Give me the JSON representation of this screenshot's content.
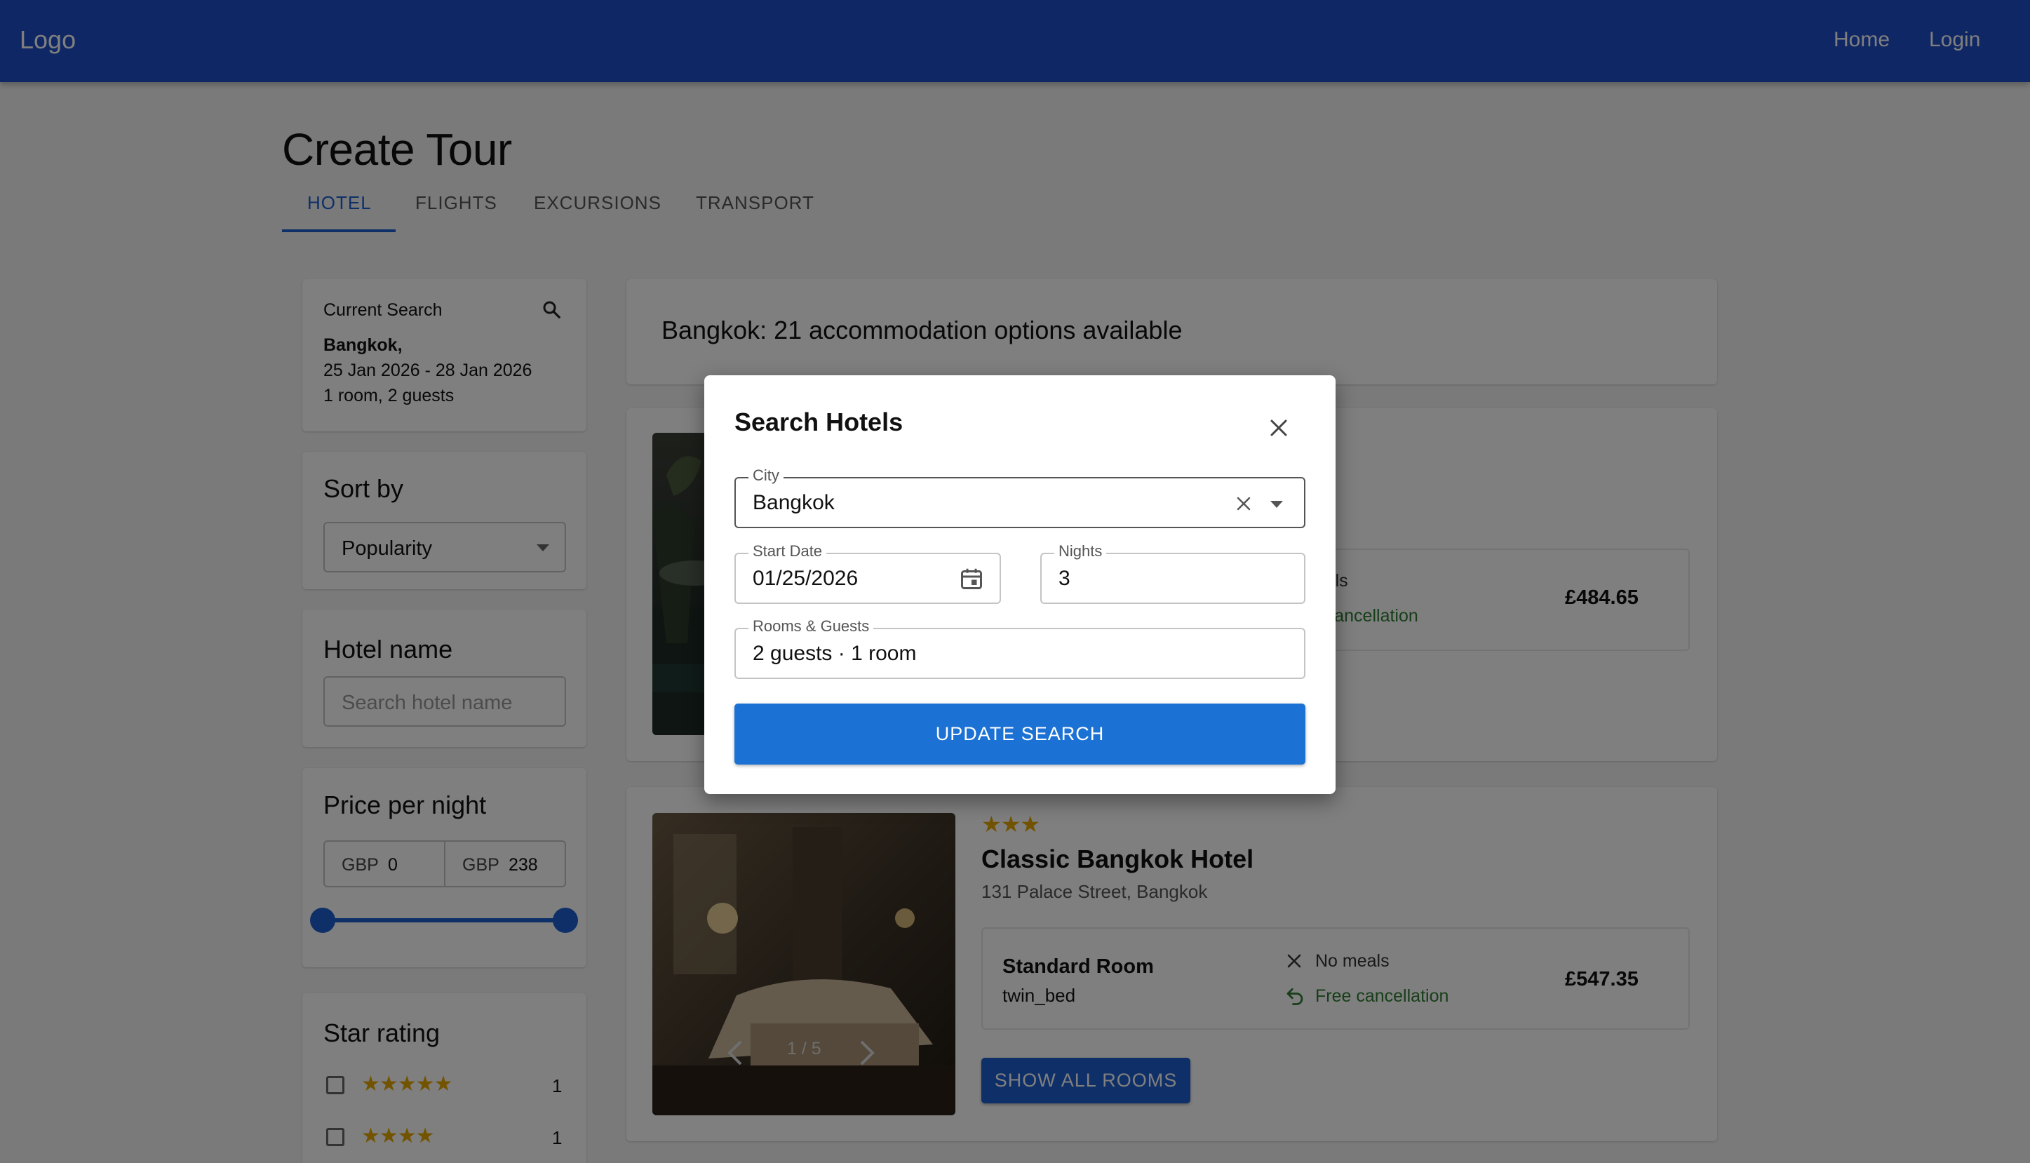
{
  "header": {
    "logo": "Logo",
    "nav": {
      "home": "Home",
      "login": "Login"
    }
  },
  "page": {
    "title": "Create Tour",
    "tabs": [
      {
        "label": "HOTEL",
        "active": true
      },
      {
        "label": "FLIGHTS",
        "active": false
      },
      {
        "label": "EXCURSIONS",
        "active": false
      },
      {
        "label": "TRANSPORT",
        "active": false
      }
    ]
  },
  "sidebar": {
    "current_search": {
      "title": "Current Search",
      "city": "Bangkok,",
      "dates": "25 Jan 2026 - 28 Jan 2026",
      "guests": "1 room, 2 guests"
    },
    "sort": {
      "heading": "Sort by",
      "value": "Popularity"
    },
    "hotel_name": {
      "heading": "Hotel name",
      "placeholder": "Search hotel name"
    },
    "price": {
      "heading": "Price per night",
      "currency_min": "GBP",
      "min": "0",
      "currency_max": "GBP",
      "max": "238",
      "range_fraction": [
        0,
        1
      ]
    },
    "star_rating": {
      "heading": "Star rating",
      "rows": [
        {
          "stars": "★★★★★",
          "count": "1"
        },
        {
          "stars": "★★★★",
          "count": "1"
        }
      ]
    }
  },
  "results": {
    "summary": "Bangkok: 21 accommodation options available",
    "hotel1": {
      "meals": "meals",
      "cancellation": "ee cancellation",
      "price": "£484.65"
    },
    "hotel2": {
      "stars": "★★★",
      "name": "Classic Bangkok Hotel",
      "address": "131 Palace Street, Bangkok",
      "room_name": "Standard Room",
      "bed": "twin_bed",
      "meals": "No meals",
      "cancellation": "Free cancellation",
      "price": "£547.35",
      "image_counter": "1 / 5",
      "show_all": "SHOW ALL ROOMS"
    }
  },
  "modal": {
    "title": "Search Hotels",
    "city_label": "City",
    "city_value": "Bangkok",
    "start_label": "Start Date",
    "start_value": "01/25/2026",
    "nights_label": "Nights",
    "nights_value": "3",
    "rooms_label": "Rooms & Guests",
    "rooms_value": "2 guests · 1 room",
    "submit": "UPDATE SEARCH"
  },
  "colors": {
    "appbar": "#1e4ec9",
    "primary": "#1d5fd0",
    "star": "#e4a600",
    "success": "#2e7d32"
  }
}
